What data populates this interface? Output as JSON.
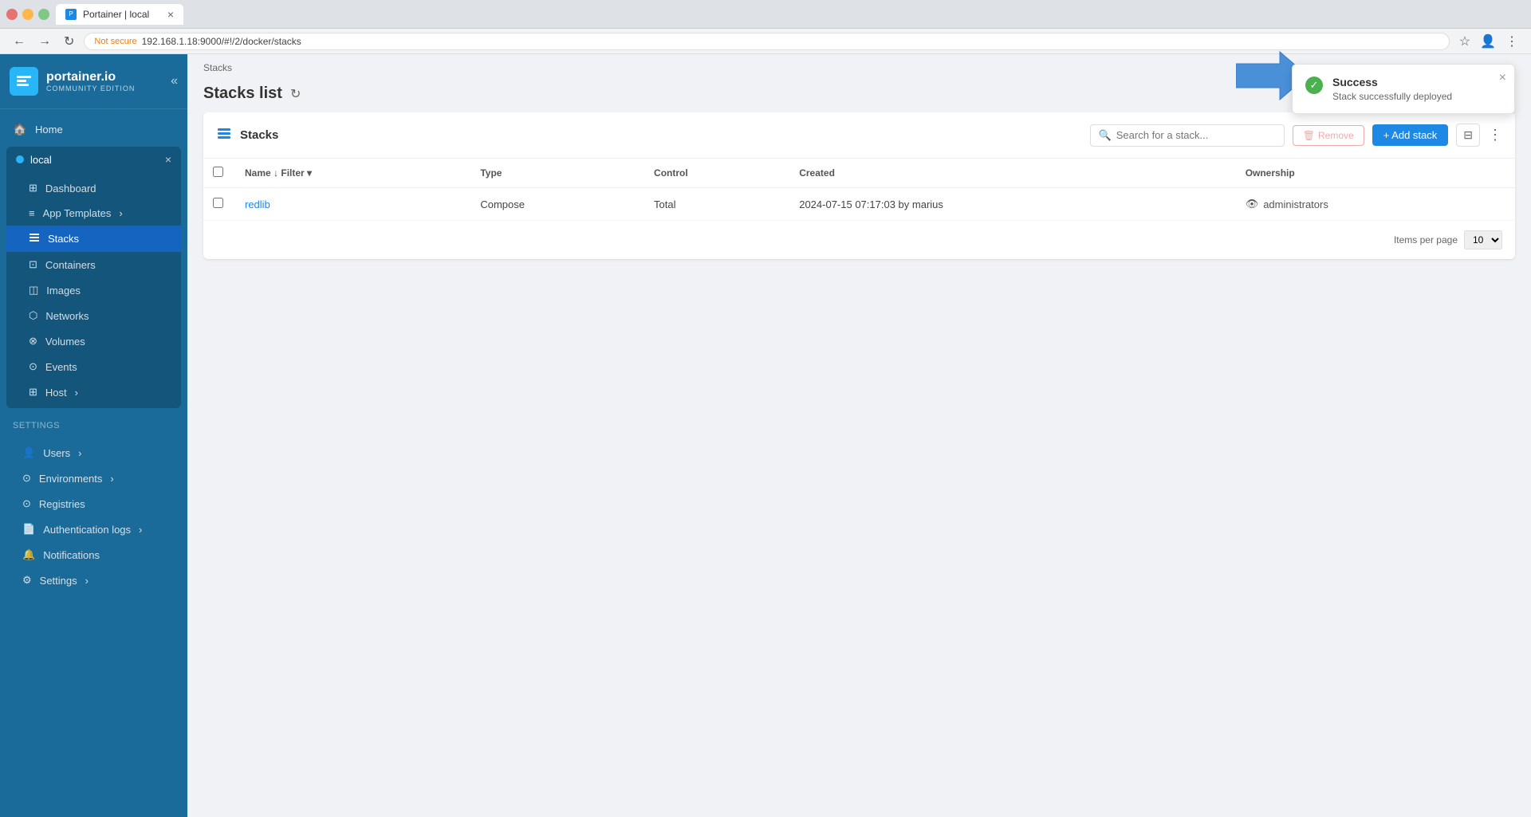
{
  "browser": {
    "tab_title": "Portainer | local",
    "url": "192.168.1.18:9000/#!/2/docker/stacks",
    "url_prefix": "Not secure",
    "back_btn": "←",
    "forward_btn": "→",
    "reload_btn": "↻"
  },
  "sidebar": {
    "logo_name": "portainer.io",
    "logo_edition": "COMMUNITY EDITION",
    "home_label": "Home",
    "env_name": "local",
    "nav_items": [
      {
        "id": "dashboard",
        "label": "Dashboard",
        "icon": "⊞"
      },
      {
        "id": "app-templates",
        "label": "App Templates",
        "icon": "≡"
      },
      {
        "id": "stacks",
        "label": "Stacks",
        "icon": "≡",
        "active": true
      },
      {
        "id": "containers",
        "label": "Containers",
        "icon": "⊡"
      },
      {
        "id": "images",
        "label": "Images",
        "icon": "◫"
      },
      {
        "id": "networks",
        "label": "Networks",
        "icon": "⬡"
      },
      {
        "id": "volumes",
        "label": "Volumes",
        "icon": "⊗"
      },
      {
        "id": "events",
        "label": "Events",
        "icon": "⏰"
      },
      {
        "id": "host",
        "label": "Host",
        "icon": "⊞"
      }
    ],
    "settings_label": "Settings",
    "settings_items": [
      {
        "id": "users",
        "label": "Users",
        "icon": "👤"
      },
      {
        "id": "environments",
        "label": "Environments",
        "icon": "⊙"
      },
      {
        "id": "registries",
        "label": "Registries",
        "icon": "⊙"
      },
      {
        "id": "auth-logs",
        "label": "Authentication logs",
        "icon": "📄"
      },
      {
        "id": "notifications",
        "label": "Notifications",
        "icon": "🔔"
      },
      {
        "id": "settings",
        "label": "Settings",
        "icon": "⚙"
      }
    ]
  },
  "page": {
    "breadcrumb": "Stacks",
    "title": "Stacks list"
  },
  "stacks_card": {
    "title": "Stacks",
    "search_placeholder": "Search for a stack...",
    "remove_label": "Remove",
    "add_label": "+ Add stack",
    "columns": {
      "name": "Name",
      "type": "Type",
      "control": "Control",
      "created": "Created",
      "ownership": "Ownership"
    },
    "rows": [
      {
        "name": "redlib",
        "type": "Compose",
        "control": "Total",
        "created": "2024-07-15 07:17:03 by marius",
        "ownership": "administrators"
      }
    ],
    "items_per_page_label": "Items per page",
    "items_per_page_value": "10"
  },
  "toast": {
    "title": "Success",
    "message": "Stack successfully deployed",
    "close": "×"
  }
}
